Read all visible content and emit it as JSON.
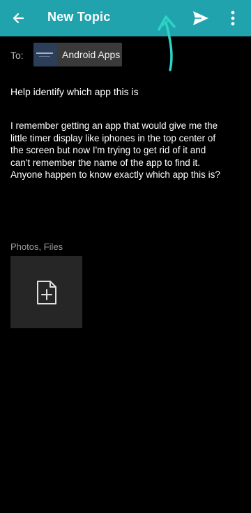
{
  "app_bar": {
    "title": "New Topic",
    "color": "#21a3ad"
  },
  "recipient": {
    "label": "To:",
    "chip_label": "Android Apps"
  },
  "subject": "Help identify which app this is",
  "body": "I remember getting an app that would give me the little timer display like iphones in the top center of the screen but now I'm trying to get rid of it and can't remember the name of the app to find it. Anyone happen to know exactly which app this is?",
  "attachments": {
    "label": "Photos, Files"
  },
  "icons": {
    "back": "arrow-left-icon",
    "send": "send-icon",
    "more": "more-vertical-icon",
    "add_file": "add-file-icon",
    "annotation": "hand-drawn-arrow"
  }
}
